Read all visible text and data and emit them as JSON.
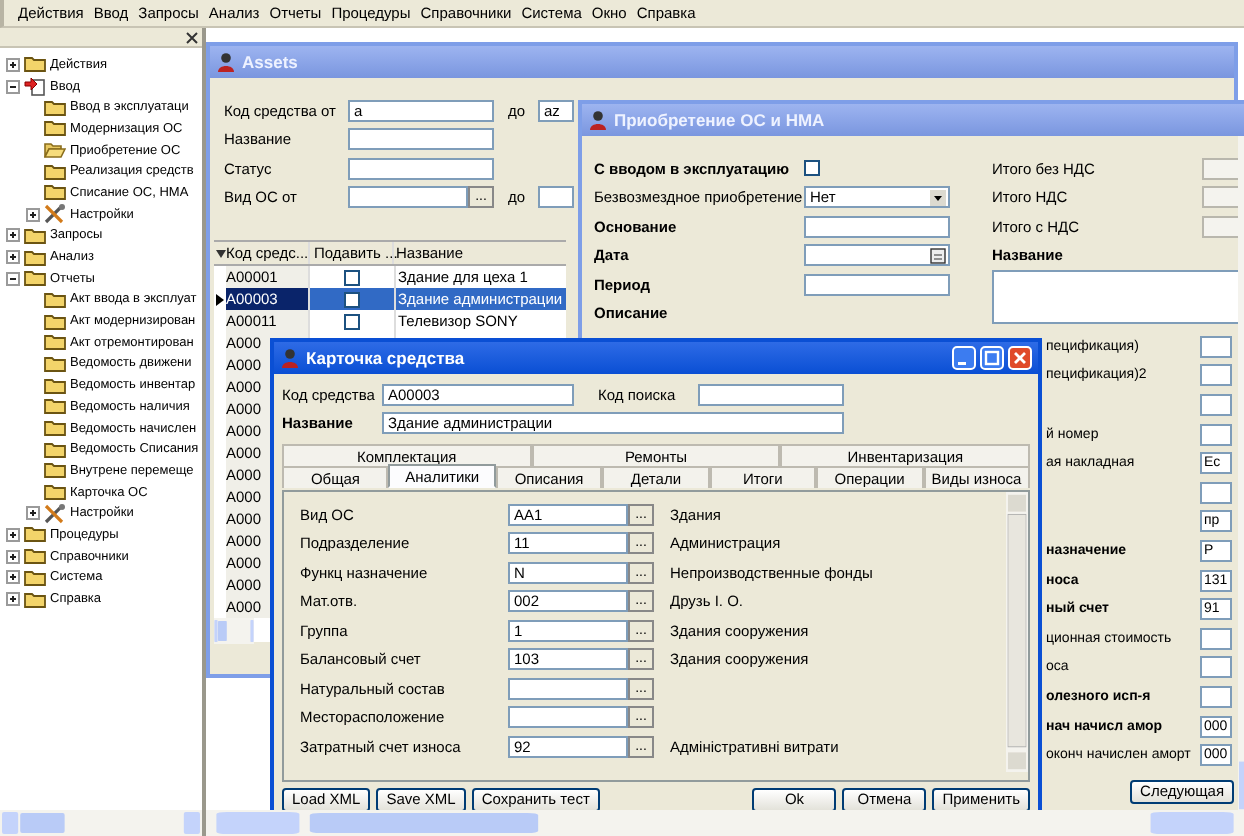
{
  "menu": [
    "Действия",
    "Ввод",
    "Запросы",
    "Анализ",
    "Отчеты",
    "Процедуры",
    "Справочники",
    "Система",
    "Окно",
    "Справка"
  ],
  "tree": [
    {
      "label": "Действия",
      "kind": "folder",
      "expanded": false
    },
    {
      "label": "Ввод",
      "kind": "input",
      "expanded": true,
      "children": [
        {
          "label": "Ввод в эксплуатаци",
          "kind": "folder"
        },
        {
          "label": "Модернизация ОС",
          "kind": "folder"
        },
        {
          "label": "Приобретение ОС",
          "kind": "folder-open"
        },
        {
          "label": "Реализация средств",
          "kind": "folder"
        },
        {
          "label": "Списание ОС, НМА",
          "kind": "folder"
        },
        {
          "label": "Настройки",
          "kind": "tools",
          "expanded": false
        }
      ]
    },
    {
      "label": "Запросы",
      "kind": "folder",
      "expanded": false
    },
    {
      "label": "Анализ",
      "kind": "folder",
      "expanded": false
    },
    {
      "label": "Отчеты",
      "kind": "folder",
      "expanded": true,
      "children": [
        {
          "label": "Акт ввода в эксплуат",
          "kind": "folder"
        },
        {
          "label": "Акт модернизирован",
          "kind": "folder"
        },
        {
          "label": "Акт отремонтирован",
          "kind": "folder"
        },
        {
          "label": "Ведомость движени",
          "kind": "folder"
        },
        {
          "label": "Ведомость инвентар",
          "kind": "folder"
        },
        {
          "label": "Ведомость наличия",
          "kind": "folder"
        },
        {
          "label": "Ведомость начислен",
          "kind": "folder"
        },
        {
          "label": "Ведомость Списания",
          "kind": "folder"
        },
        {
          "label": "Внутрене перемеще",
          "kind": "folder"
        },
        {
          "label": "Карточка ОС",
          "kind": "folder"
        },
        {
          "label": "Настройки",
          "kind": "tools",
          "expanded": false
        }
      ]
    },
    {
      "label": "Процедуры",
      "kind": "folder",
      "expanded": false
    },
    {
      "label": "Справочники",
      "kind": "folder",
      "expanded": false
    },
    {
      "label": "Система",
      "kind": "folder",
      "expanded": false
    },
    {
      "label": "Справка",
      "kind": "folder",
      "expanded": false
    }
  ],
  "assets_window": {
    "title": "Assets",
    "filters": [
      {
        "label": "Код средства от",
        "value": "a",
        "to_label": "до",
        "to_value": "az"
      },
      {
        "label": "Название"
      },
      {
        "label": "Статус"
      },
      {
        "label": "Вид ОС от",
        "browse": "...",
        "to_label": "до"
      }
    ],
    "grid": {
      "columns": [
        "Код средс...",
        "Подавить ...",
        "Название"
      ],
      "rows": [
        {
          "code": "A00001",
          "suppress": false,
          "name": "Здание для цеха 1",
          "selected": false
        },
        {
          "code": "A00003",
          "suppress": false,
          "name": "Здание администрации",
          "selected": true
        },
        {
          "code": "A00011",
          "suppress": false,
          "name": "Телевизор SONY",
          "selected": false
        },
        {
          "code": "A000",
          "selected": false
        },
        {
          "code": "A000",
          "selected": false
        },
        {
          "code": "A000",
          "selected": false
        },
        {
          "code": "A000",
          "selected": false
        },
        {
          "code": "A000",
          "selected": false
        },
        {
          "code": "A000",
          "selected": false
        },
        {
          "code": "A000",
          "selected": false
        },
        {
          "code": "A000",
          "selected": false
        },
        {
          "code": "A000",
          "selected": false
        },
        {
          "code": "A000",
          "selected": false
        },
        {
          "code": "A000",
          "selected": false
        },
        {
          "code": "A000",
          "selected": false
        },
        {
          "code": "A000",
          "selected": false
        }
      ]
    }
  },
  "purchase_window": {
    "title": "Приобретение ОС и НМА",
    "left_fields": [
      {
        "label": "С вводом в эксплуатацию",
        "bold": true,
        "kind": "checkbox",
        "checked": false
      },
      {
        "label": "Безвозмездное приобретение",
        "bold": false,
        "kind": "select",
        "value": "Нет"
      },
      {
        "label": "Основание",
        "bold": true,
        "kind": "text"
      },
      {
        "label": "Дата",
        "bold": true,
        "kind": "date"
      },
      {
        "label": "Период",
        "bold": true,
        "kind": "text"
      },
      {
        "label": "Описание",
        "bold": true,
        "kind": "memo"
      }
    ],
    "right_fields": [
      {
        "label": "Итого без НДС"
      },
      {
        "label": "Итого НДС"
      },
      {
        "label": "Итого с НДС"
      }
    ],
    "name_label": "Название",
    "lower_fields": [
      {
        "kind": "field",
        "label": "пецификация)",
        "bold": false
      },
      {
        "kind": "field",
        "label": "пецификация)2",
        "bold": false
      },
      {
        "kind": "field"
      },
      {
        "kind": "field",
        "label": "й номер",
        "bold": false
      },
      {
        "kind": "field",
        "label": "ая накладная",
        "bold": false,
        "value": "Ес"
      },
      {
        "kind": "field"
      },
      {
        "kind": "field",
        "value": "пр"
      },
      {
        "kind": "field",
        "label": "назначение",
        "bold": true,
        "value": "Р"
      },
      {
        "kind": "field",
        "label": "носа",
        "bold": true,
        "value": "131"
      },
      {
        "kind": "field",
        "label": "ный счет",
        "bold": true,
        "value": "91"
      },
      {
        "kind": "field",
        "label": "ционная стоимость",
        "bold": false
      },
      {
        "kind": "field",
        "label": "оса",
        "bold": false
      },
      {
        "kind": "field",
        "label": "олезного исп-я",
        "bold": true
      },
      {
        "kind": "field",
        "label": "нач начисл амор",
        "bold": true,
        "value": "000"
      },
      {
        "kind": "field",
        "label": "оконч начислен аморт",
        "bold": false,
        "value": "000"
      }
    ],
    "next_button": "Следующая"
  },
  "card_window": {
    "title": "Карточка средства",
    "code_label": "Код средства",
    "code_value": "A00003",
    "search_label": "Код поиска",
    "name_label": "Название",
    "name_value": "Здание администрации",
    "tabs_row_1": [
      {
        "label": "Комплектация",
        "selected": false
      },
      {
        "label": "Ремонты",
        "selected": false
      },
      {
        "label": "Инвентаризация",
        "selected": false
      }
    ],
    "tabs_row_2": [
      {
        "label": "Общая",
        "selected": false
      },
      {
        "label": "Аналитики",
        "selected": true
      },
      {
        "label": "Описания",
        "selected": false
      },
      {
        "label": "Детали",
        "selected": false
      },
      {
        "label": "Итоги",
        "selected": false
      },
      {
        "label": "Операции",
        "selected": false
      },
      {
        "label": "Виды износа",
        "selected": false
      }
    ],
    "fields": [
      {
        "label": "Вид ОС",
        "value": "AA1",
        "browse": "...",
        "description": "Здания"
      },
      {
        "label": "Подразделение",
        "value": "11",
        "browse": "...",
        "description": "Администрация"
      },
      {
        "label": "Функц назначение",
        "value": "N",
        "browse": "...",
        "description": "Непроизводственные фонды"
      },
      {
        "label": "Мат.отв.",
        "value": "002",
        "browse": "...",
        "description": "Друзь І. О."
      },
      {
        "label": "Группа",
        "value": "1",
        "browse": "...",
        "description": "Здания сооружения"
      },
      {
        "label": "Балансовый счет",
        "value": "103",
        "browse": "...",
        "description": "Здания сооружения"
      },
      {
        "label": "Натуральный состав",
        "browse": "..."
      },
      {
        "label": "Месторасположение",
        "browse": "..."
      },
      {
        "label": "Затратный счет износа",
        "value": "92",
        "browse": "...",
        "description": "Адміністративні витрати"
      }
    ],
    "buttons": [
      "Load XML",
      "Save XML",
      "Сохранить тест",
      "Ok",
      "Отмена",
      "Применить"
    ]
  }
}
